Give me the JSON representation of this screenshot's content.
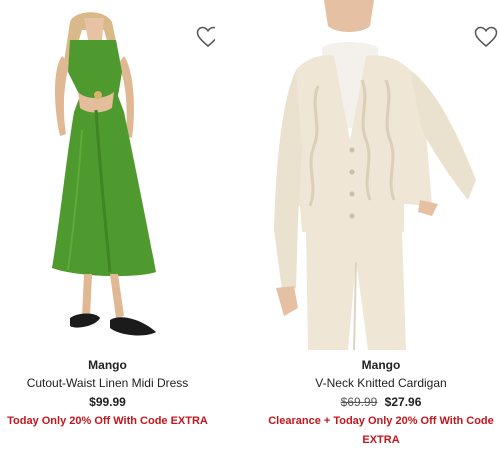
{
  "products": [
    {
      "image_alt": "green cutout dress",
      "brand": "Mango",
      "name": "Cutout-Waist Linen Midi Dress",
      "price": "$99.99",
      "promo": "Today Only 20% Off With Code EXTRA",
      "favorite_icon": "heart-outline-icon"
    },
    {
      "image_alt": "cream cable knit cardigan",
      "brand": "Mango",
      "name": "V-Neck Knitted Cardigan",
      "original_price": "$69.99",
      "price": "$27.96",
      "promo": "Clearance + Today Only 20% Off With Code EXTRA",
      "favorite_icon": "heart-outline-icon"
    }
  ],
  "colors": {
    "promo": "#c4161c",
    "dress": "#4f9a2e",
    "cardigan": "#efe6d6"
  }
}
